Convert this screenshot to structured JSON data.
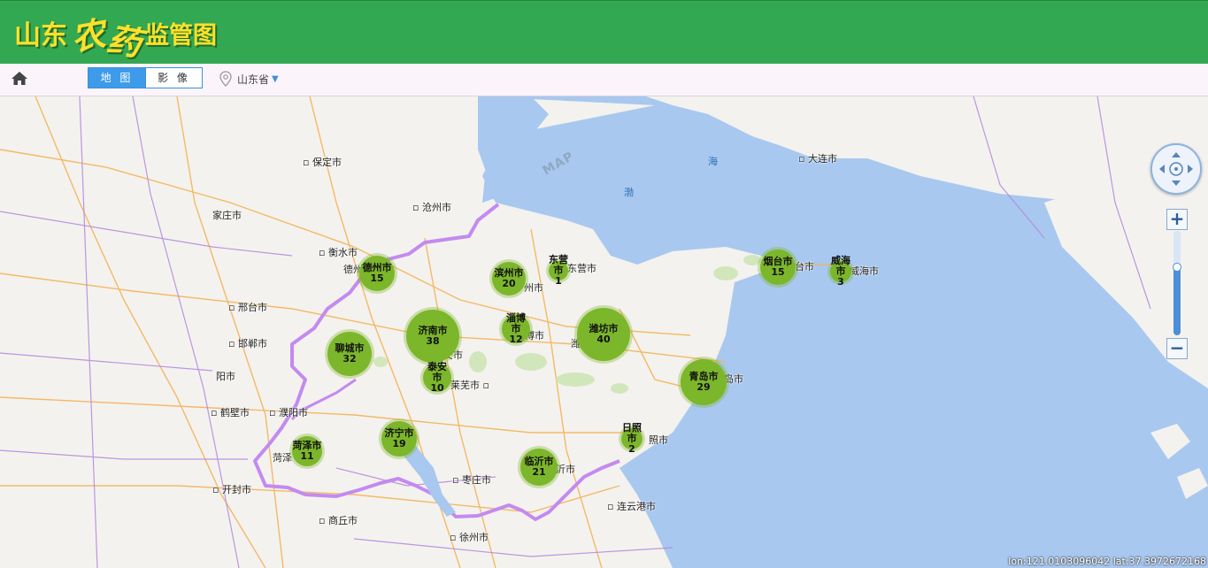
{
  "header": {
    "logo_1": "山东",
    "logo_2": "农",
    "logo_3": "药",
    "logo_4": "监管图",
    "bg_color": "#33a852"
  },
  "toolbar": {
    "home_icon": "home-icon",
    "map_btn": "地 图",
    "image_btn": "影 像",
    "region_label": "山东省",
    "region_icon": "location-pin-icon",
    "region_arrow": "▼"
  },
  "map": {
    "watermark": "MAP",
    "sea_labels": [
      {
        "name": "海"
      },
      {
        "name": "渤"
      }
    ],
    "cities": [
      {
        "name": "保定市"
      },
      {
        "name": "沧州市"
      },
      {
        "name": "家庄市"
      },
      {
        "name": "衡水市"
      },
      {
        "name": "德州市"
      },
      {
        "name": "邢台市"
      },
      {
        "name": "邯郸市"
      },
      {
        "name": "阳市"
      },
      {
        "name": "鹤壁市"
      },
      {
        "name": "濮阳市"
      },
      {
        "name": "开封市"
      },
      {
        "name": "商丘市"
      },
      {
        "name": "徐州市"
      },
      {
        "name": "枣庄市"
      },
      {
        "name": "连云港市"
      },
      {
        "name": "大连市"
      },
      {
        "name": "东营市"
      },
      {
        "name": "莱芜市"
      },
      {
        "name": "菏泽"
      },
      {
        "name": "照市"
      },
      {
        "name": "岛市"
      },
      {
        "name": "台市"
      },
      {
        "name": "威海市"
      },
      {
        "name": "州市"
      },
      {
        "name": "博市"
      },
      {
        "name": "潍"
      },
      {
        "name": "安市"
      },
      {
        "name": "沂市"
      }
    ],
    "clusters": [
      {
        "name": "德州市",
        "count": "15"
      },
      {
        "name": "滨州市",
        "count": "20"
      },
      {
        "name": "东营市",
        "count": "1"
      },
      {
        "name": "烟台市",
        "count": "15"
      },
      {
        "name": "威海市",
        "count": "3"
      },
      {
        "name": "淄博市",
        "count": "12"
      },
      {
        "name": "济南市",
        "count": "38"
      },
      {
        "name": "潍坊市",
        "count": "40"
      },
      {
        "name": "聊城市",
        "count": "32"
      },
      {
        "name": "泰安市",
        "count": "10"
      },
      {
        "name": "青岛市",
        "count": "29"
      },
      {
        "name": "日照市",
        "count": "2"
      },
      {
        "name": "济宁市",
        "count": "19"
      },
      {
        "name": "菏泽市",
        "count": "11"
      },
      {
        "name": "临沂市",
        "count": "21"
      }
    ],
    "coordinates": "lon:121.0103096042 lat:37.3972672168"
  },
  "controls": {
    "pan_icon": "pan-compass-icon",
    "zoom_in": "+",
    "zoom_out": "−",
    "zoom_level": 0.65
  }
}
